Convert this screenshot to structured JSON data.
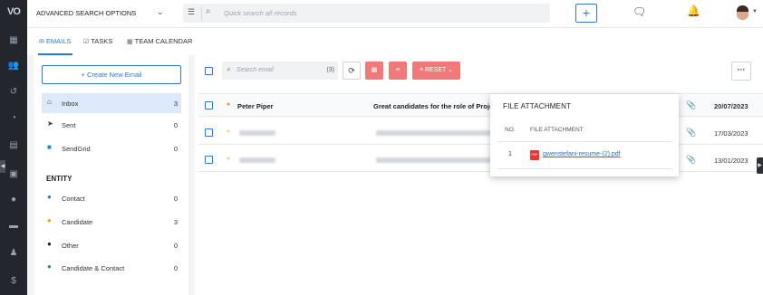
{
  "app": {
    "logo": "VO"
  },
  "topbar": {
    "advanced_search": "ADVANCED SEARCH OPTIONS",
    "search_placeholder": "Quick search all records",
    "plus_label": "+"
  },
  "tabs": [
    {
      "label": "EMAILS",
      "icon": "envelope-icon",
      "active": true
    },
    {
      "label": "TASKS",
      "icon": "checkbox-icon",
      "active": false
    },
    {
      "label": "TEAM CALENDAR",
      "icon": "calendar-icon",
      "active": false
    }
  ],
  "sidebar": {
    "create_button": "+ Create New Email",
    "folders": [
      {
        "label": "Inbox",
        "count": "3",
        "icon": "inbox-icon",
        "selected": true
      },
      {
        "label": "Sent",
        "count": "0",
        "icon": "send-icon",
        "selected": false
      },
      {
        "label": "SendGrid",
        "count": "0",
        "icon": "sendgrid-icon",
        "selected": false
      }
    ],
    "entity_heading": "ENTITY",
    "entities": [
      {
        "label": "Contact",
        "count": "0",
        "icon": "contact-icon"
      },
      {
        "label": "Candidate",
        "count": "3",
        "icon": "candidate-icon"
      },
      {
        "label": "Other",
        "count": "0",
        "icon": "other-icon"
      },
      {
        "label": "Candidate & Contact",
        "count": "0",
        "icon": "candidate-contact-icon"
      }
    ]
  },
  "toolbar": {
    "search_placeholder": "Search email",
    "count": "(3)",
    "reset_label": "RESET",
    "more_label": "···"
  },
  "emails": [
    {
      "from": "Peter Piper",
      "subject": "Great candidates for the role of Proje",
      "date": "20/07/2023",
      "has_attachment": true,
      "blurred": false
    },
    {
      "from": "",
      "subject": "",
      "date": "17/03/2023",
      "has_attachment": true,
      "blurred": true
    },
    {
      "from": "",
      "subject": "",
      "date": "13/01/2023",
      "has_attachment": true,
      "blurred": true
    }
  ],
  "attachment_popup": {
    "title": "FILE ATTACHMENT",
    "col_no": "NO.",
    "col_file": "FILE ATTACHMENT",
    "rows": [
      {
        "no": "1",
        "file": "gwenstefani-resume-(2).pdf",
        "type": "PDF"
      }
    ]
  },
  "colors": {
    "accent": "#2b7bd6",
    "danger": "#f07a7a",
    "sidebar_bg": "#23262d"
  }
}
